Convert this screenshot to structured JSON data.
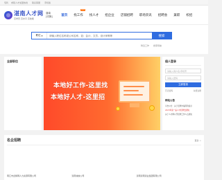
{
  "topbar": {
    "left": "毛利",
    "links": [
      "求职人才加盟热线",
      "联系客服",
      "手机版"
    ]
  },
  "header": {
    "logo_title": "湛南人才网",
    "logo_sub": "高学历 高水平 高技能",
    "city_label": "湛南",
    "city_switch": "[切换]"
  },
  "nav": [
    {
      "label": "首页",
      "active": true
    },
    {
      "label": "找工作",
      "hot": "HOT"
    },
    {
      "label": "找人才"
    },
    {
      "label": "招企业"
    },
    {
      "label": "店铺招聘"
    },
    {
      "label": "职场资讯"
    },
    {
      "label": "招聘会"
    },
    {
      "label": "兼职"
    },
    {
      "label": "校招"
    }
  ],
  "search": {
    "type_label": "职位",
    "placeholder": "请输入职位名称或公司名称，如：会计、文员、设计师等等",
    "button": "搜索",
    "links": [
      "附近工作",
      "搜索导航"
    ]
  },
  "left_panel": {
    "title": "全部职位"
  },
  "banner": {
    "line1": "本地好工作-这里找",
    "line2": "本地好人才-这里招"
  },
  "login": {
    "tab": "個人登录",
    "username_placeholder": "请输入用户名/手机号",
    "password_placeholder": "请输入密码",
    "button": "立即登录",
    "forgot": "忘记密码",
    "register": "免费注册"
  },
  "notice": {
    "title": "网站公告",
    "items": [
      {
        "text": "平台公告：关于招聘诈骗风险提示",
        "red": false
      },
      {
        "text": "2023年第一届人才招聘会通知",
        "red": true
      },
      {
        "text": "关于人才网公开招聘工作人员通知",
        "red": false
      }
    ]
  },
  "famous": {
    "title": "名企招聘",
    "more": "更多 >",
    "companies": [
      "南江市企鹅网人力资源有限公司",
      "湛南诚信公司",
      "湛南湛南湛业集团有限公司"
    ]
  },
  "colors": {
    "accent": "#2f6ce0",
    "banner_orange": "#ff4a2a",
    "hot": "#ff6a00"
  }
}
